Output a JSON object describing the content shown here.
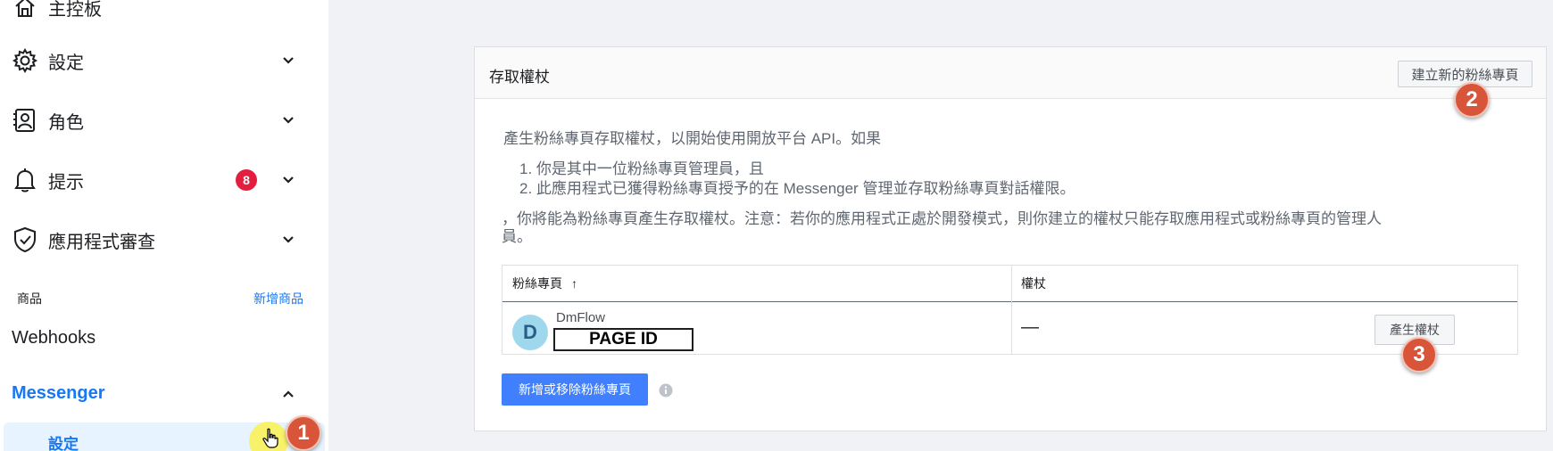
{
  "sidebar": {
    "items": [
      {
        "label": "主控板",
        "icon": "home-icon"
      },
      {
        "label": "設定",
        "icon": "gear-icon"
      },
      {
        "label": "角色",
        "icon": "roles-icon"
      },
      {
        "label": "提示",
        "icon": "bell-icon",
        "badge": "8"
      },
      {
        "label": "應用程式審查",
        "icon": "shield-check-icon"
      }
    ],
    "products_heading": "商品",
    "add_product_link": "新增商品",
    "webhooks": "Webhooks",
    "messenger": "Messenger",
    "messenger_settings": "設定"
  },
  "markers": [
    "1",
    "2",
    "3"
  ],
  "card": {
    "title": "存取權杖",
    "create_page_button": "建立新的粉絲專頁",
    "intro": "產生粉絲專頁存取權杖，以開始使用開放平台 API。如果",
    "conditions": [
      "1. 你是其中一位粉絲專頁管理員，且",
      "2. 此應用程式已獲得粉絲專頁授予的在 Messenger 管理並存取粉絲專頁對話權限。"
    ],
    "note_line1": "，你將能為粉絲專頁產生存取權杖。注意：若你的應用程式正處於開發模式，則你建立的權杖只能存取應用程式或粉絲專頁的管理人",
    "note_line2": "員。",
    "table": {
      "col_page": "粉絲專頁",
      "sort_indicator": "↑",
      "col_token": "權杖",
      "row": {
        "avatar_letter": "D",
        "page_name": "DmFlow",
        "page_id_label": "PAGE ID",
        "token": "—",
        "generate_button": "產生權杖"
      }
    },
    "add_remove_button": "新增或移除粉絲專頁"
  },
  "colors": {
    "accent": "#1877f2",
    "button_blue": "#4080ff",
    "badge_red": "#e41e3f",
    "marker": "#d9553a"
  }
}
